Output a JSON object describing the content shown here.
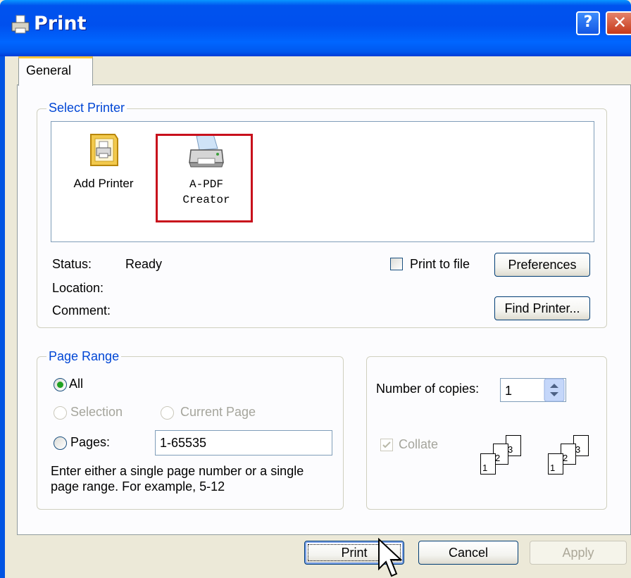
{
  "window": {
    "title": "Print",
    "help_label": "?",
    "close_label": "✕"
  },
  "tabs": {
    "general": "General"
  },
  "select_printer": {
    "legend": "Select Printer",
    "printers": [
      {
        "name": "Add Printer",
        "icon": "add-printer-icon"
      },
      {
        "name_line1": "A-PDF",
        "name_line2": "Creator",
        "icon": "printer-icon",
        "selected": true
      }
    ],
    "status_label": "Status:",
    "status_value": "Ready",
    "location_label": "Location:",
    "comment_label": "Comment:",
    "print_to_file_label": "Print to file",
    "print_to_file_checked": false,
    "preferences_label": "Preferences",
    "find_printer_label": "Find Printer..."
  },
  "page_range": {
    "legend": "Page Range",
    "all_label": "All",
    "all_selected": true,
    "selection_label": "Selection",
    "current_page_label": "Current Page",
    "pages_label": "Pages:",
    "pages_value": "1-65535",
    "help_text_line1": "Enter either a single page number or a single",
    "help_text_line2": "page range.  For example, 5-12"
  },
  "copies": {
    "label": "Number of copies:",
    "value": "1",
    "collate_label": "Collate",
    "collate_checked": true,
    "collate_pages": [
      "1",
      "2",
      "3"
    ]
  },
  "buttons": {
    "print": "Print",
    "cancel": "Cancel",
    "apply": "Apply"
  },
  "colors": {
    "titlebar": "#0058EE",
    "legend": "#0046D5",
    "tab_highlight": "#FFC83C",
    "selection_box": "#C8101C"
  }
}
